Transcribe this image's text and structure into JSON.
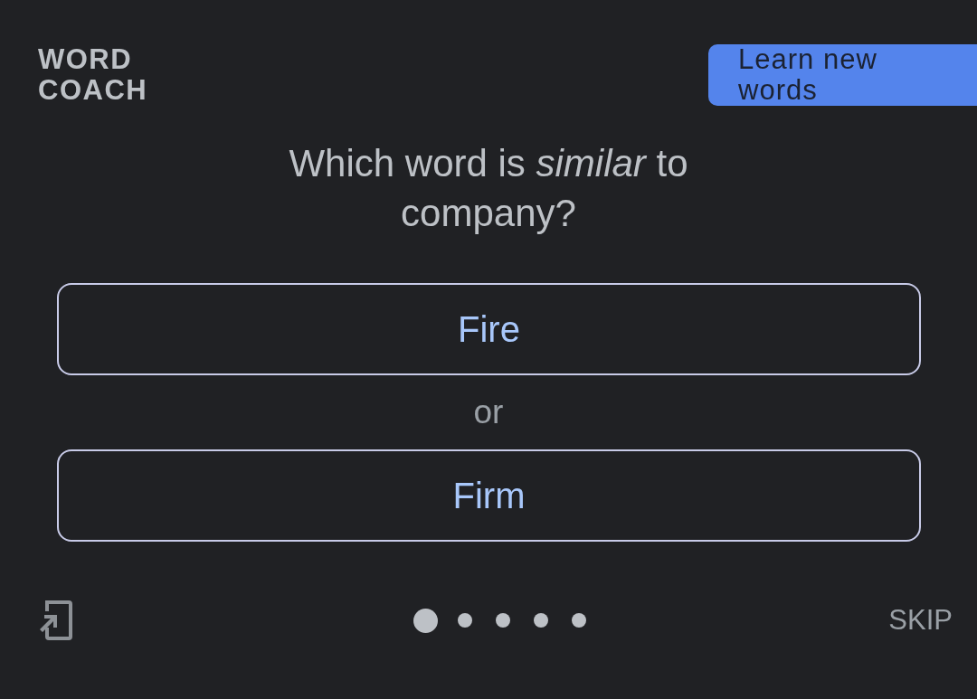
{
  "header": {
    "title": "WORD COACH",
    "learn_button": "Learn new words"
  },
  "question": "Which word is *similar* to company?",
  "options": [
    {
      "label": "Fire"
    },
    {
      "label": "Firm"
    }
  ],
  "separator": "or",
  "footer": {
    "progress": [
      {
        "selected": true
      },
      {
        "selected": false
      },
      {
        "selected": false
      },
      {
        "selected": false
      },
      {
        "selected": false
      }
    ],
    "skip": "SKIP"
  }
}
